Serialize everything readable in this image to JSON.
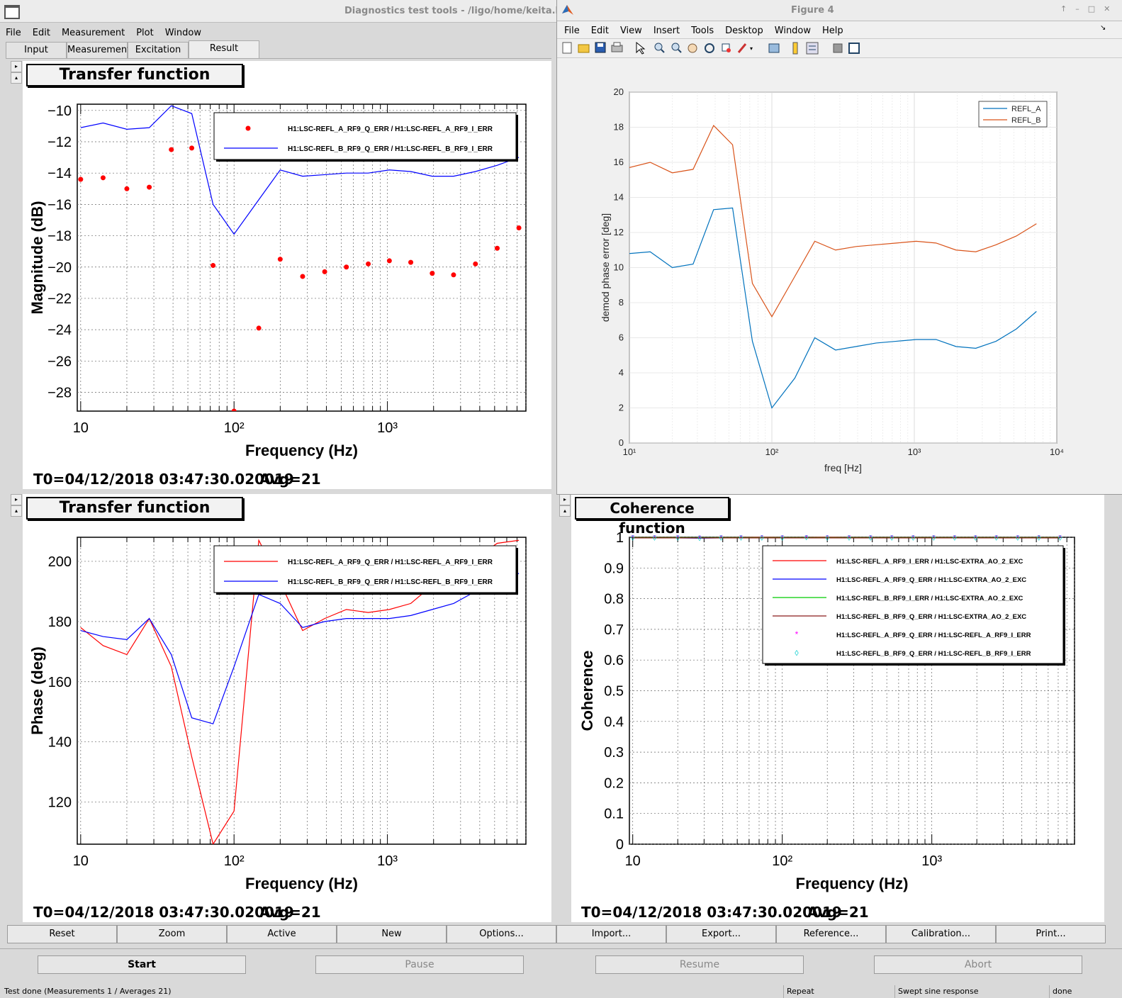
{
  "main_window": {
    "title": "Diagnostics test tools - /ligo/home/keita.l",
    "menu": [
      "File",
      "Edit",
      "Measurement",
      "Plot",
      "Window"
    ],
    "tabs": [
      "Input",
      "Measurement",
      "Excitation",
      "Result"
    ],
    "active_tab": "Result"
  },
  "figure_window": {
    "title": "Figure 4",
    "menu": [
      "File",
      "Edit",
      "View",
      "Insert",
      "Tools",
      "Desktop",
      "Window",
      "Help"
    ]
  },
  "buttons": {
    "row": [
      "Reset",
      "Zoom",
      "Active",
      "New",
      "Options...",
      "Import...",
      "Export...",
      "Reference...",
      "Calibration...",
      "Print..."
    ],
    "start": "Start",
    "pause": "Pause",
    "resume": "Resume",
    "abort": "Abort"
  },
  "status": {
    "message": "Test done (Measurements 1 / Averages 21)",
    "mode": "Repeat",
    "type": "Swept sine response",
    "state": "done"
  },
  "colors": {
    "red": "#ff0000",
    "blue": "#0000ff",
    "green": "#00cc00",
    "darkred": "#8b1a1a",
    "magenta": "#ff00ff",
    "cyan": "#00cccc",
    "matlab_blue": "#0072bd",
    "matlab_orange": "#d95319"
  },
  "chart_data": [
    {
      "panel": "top-left",
      "type": "line",
      "panel_title": "Transfer function",
      "xlabel": "Frequency (Hz)",
      "ylabel": "Magnitude (dB)",
      "xscale": "log",
      "xlim": [
        9.5,
        8000
      ],
      "ylim": [
        -29.2,
        -9.6
      ],
      "yticks": [
        -10,
        -12,
        -14,
        -16,
        -18,
        -20,
        -22,
        -24,
        -26,
        -28
      ],
      "xtick_labels": [
        "10",
        "10²",
        "10³"
      ],
      "x": [
        10,
        14,
        20,
        28,
        39,
        53,
        73,
        100,
        145,
        200,
        280,
        390,
        540,
        750,
        1030,
        1420,
        1960,
        2700,
        3750,
        5200,
        7200
      ],
      "series": [
        {
          "name": "H1:LSC-REFL_A_RF9_Q_ERR / H1:LSC-REFL_A_RF9_I_ERR",
          "style": "markers",
          "color": "#ff0000",
          "values": [
            -14.4,
            -14.3,
            -15.0,
            -14.9,
            -12.5,
            -12.4,
            -19.9,
            -29.2,
            -23.9,
            -19.5,
            -20.6,
            -20.3,
            -20.0,
            -19.8,
            -19.6,
            -19.7,
            -20.4,
            -20.5,
            -19.8,
            -18.8,
            -17.5
          ]
        },
        {
          "name": "H1:LSC-REFL_B_RF9_Q_ERR / H1:LSC-REFL_B_RF9_I_ERR",
          "style": "line",
          "color": "#0000ff",
          "values": [
            -11.1,
            -10.8,
            -11.2,
            -11.1,
            -9.7,
            -10.2,
            -16.0,
            -17.9,
            -15.7,
            -13.8,
            -14.2,
            -14.1,
            -14.0,
            -14.0,
            -13.8,
            -13.9,
            -14.2,
            -14.2,
            -13.9,
            -13.5,
            -13.0
          ]
        }
      ],
      "footer": "T0=04/12/2018 03:47:30.020019",
      "avg": "Avg=21"
    },
    {
      "panel": "bottom-left",
      "type": "line",
      "panel_title": "Transfer function",
      "xlabel": "Frequency (Hz)",
      "ylabel": "Phase (deg)",
      "xscale": "log",
      "xlim": [
        9.5,
        8000
      ],
      "ylim": [
        106,
        208
      ],
      "yticks": [
        120,
        140,
        160,
        180,
        200
      ],
      "xtick_labels": [
        "10",
        "10²",
        "10³"
      ],
      "x": [
        10,
        14,
        20,
        28,
        39,
        53,
        73,
        100,
        145,
        200,
        280,
        390,
        540,
        750,
        1030,
        1420,
        1960,
        2700,
        3750,
        5200,
        7200
      ],
      "series": [
        {
          "name": "H1:LSC-REFL_A_RF9_Q_ERR / H1:LSC-REFL_A_RF9_I_ERR",
          "style": "line",
          "color": "#ff0000",
          "values": [
            178,
            172,
            169,
            181,
            165,
            135,
            106,
            117,
            207,
            193,
            177,
            181,
            184,
            183,
            184,
            186,
            192,
            198,
            201,
            206,
            207
          ]
        },
        {
          "name": "H1:LSC-REFL_B_RF9_Q_ERR / H1:LSC-REFL_B_RF9_I_ERR",
          "style": "line",
          "color": "#0000ff",
          "values": [
            177,
            175,
            174,
            181,
            169,
            148,
            146,
            165,
            189,
            186,
            178,
            180,
            181,
            181,
            181,
            182,
            184,
            186,
            190,
            193,
            196
          ]
        }
      ],
      "footer": "T0=04/12/2018 03:47:30.020019",
      "avg": "Avg=21"
    },
    {
      "panel": "top-right",
      "type": "line",
      "xlabel": "freq [Hz]",
      "ylabel": "demod phase error [deg]",
      "xscale": "log",
      "xlim": [
        10,
        10000
      ],
      "ylim": [
        0,
        20
      ],
      "yticks": [
        0,
        2,
        4,
        6,
        8,
        10,
        12,
        14,
        16,
        18,
        20
      ],
      "xtick_labels": [
        "10¹",
        "10²",
        "10³",
        "10⁴"
      ],
      "grid": true,
      "legend_position": "top-right",
      "x": [
        10,
        14,
        20,
        28,
        39,
        53,
        73,
        100,
        145,
        200,
        280,
        390,
        540,
        750,
        1030,
        1420,
        1960,
        2700,
        3750,
        5200,
        7200
      ],
      "series": [
        {
          "name": "REFL_A",
          "color": "#0072bd",
          "values": [
            10.8,
            10.9,
            10.0,
            10.2,
            13.3,
            13.4,
            5.8,
            2.0,
            3.7,
            6.0,
            5.3,
            5.5,
            5.7,
            5.8,
            5.9,
            5.9,
            5.5,
            5.4,
            5.8,
            6.5,
            7.5
          ]
        },
        {
          "name": "REFL_B",
          "color": "#d95319",
          "values": [
            15.7,
            16.0,
            15.4,
            15.6,
            18.1,
            17.0,
            9.1,
            7.2,
            9.5,
            11.5,
            11.0,
            11.2,
            11.3,
            11.4,
            11.5,
            11.4,
            11.0,
            10.9,
            11.3,
            11.8,
            12.5
          ]
        }
      ]
    },
    {
      "panel": "bottom-right",
      "type": "line",
      "panel_title": "Coherence function",
      "xlabel": "Frequency (Hz)",
      "ylabel": "Coherence",
      "xscale": "log",
      "xlim": [
        9.5,
        9000
      ],
      "ylim": [
        0,
        1
      ],
      "yticks": [
        0,
        0.1,
        0.2,
        0.3,
        0.4,
        0.5,
        0.6,
        0.7,
        0.8,
        0.9,
        1
      ],
      "ytick_labels": [
        "0",
        "0.1",
        "0.2",
        "0.3",
        "0.4",
        "0.5",
        "0.6",
        "0.7",
        "0.8",
        "0.9",
        "1"
      ],
      "xtick_labels": [
        "10",
        "10²",
        "10³"
      ],
      "x": [
        10,
        14,
        20,
        28,
        39,
        53,
        73,
        100,
        145,
        200,
        280,
        390,
        540,
        750,
        1030,
        1420,
        1960,
        2700,
        3750,
        5200,
        7200
      ],
      "series": [
        {
          "name": "H1:LSC-REFL_A_RF9_I_ERR / H1:LSC-EXTRA_AO_2_EXC",
          "style": "line",
          "color": "#ff0000",
          "values": [
            0.999,
            0.999,
            0.999,
            0.998,
            0.999,
            0.999,
            1,
            0.999,
            0.999,
            1,
            0.999,
            0.999,
            0.999,
            0.999,
            0.999,
            0.999,
            0.999,
            0.999,
            0.999,
            0.999,
            0.999
          ]
        },
        {
          "name": "H1:LSC-REFL_A_RF9_Q_ERR / H1:LSC-EXTRA_AO_2_EXC",
          "style": "line",
          "color": "#0000ff",
          "values": [
            0.998,
            0.998,
            0.998,
            0.997,
            0.998,
            0.998,
            0.999,
            0.998,
            0.998,
            0.999,
            0.998,
            0.998,
            0.998,
            0.998,
            0.998,
            0.998,
            0.998,
            0.998,
            0.998,
            0.998,
            0.998
          ]
        },
        {
          "name": "H1:LSC-REFL_B_RF9_I_ERR / H1:LSC-EXTRA_AO_2_EXC",
          "style": "line",
          "color": "#00cc00",
          "values": [
            0.999,
            0.999,
            0.999,
            0.999,
            0.999,
            0.999,
            0.999,
            0.999,
            0.999,
            0.999,
            0.999,
            0.999,
            0.999,
            0.999,
            0.999,
            0.999,
            0.999,
            0.999,
            0.999,
            0.999,
            0.999
          ]
        },
        {
          "name": "H1:LSC-REFL_B_RF9_Q_ERR / H1:LSC-EXTRA_AO_2_EXC",
          "style": "line",
          "color": "#8b1a1a",
          "values": [
            0.998,
            0.998,
            0.998,
            0.998,
            0.998,
            0.998,
            0.998,
            0.998,
            0.998,
            0.998,
            0.998,
            0.998,
            0.998,
            0.998,
            0.998,
            0.998,
            0.998,
            0.998,
            0.998,
            0.998,
            0.998
          ]
        },
        {
          "name": "H1:LSC-REFL_A_RF9_Q_ERR / H1:LSC-REFL_A_RF9_I_ERR",
          "style": "markers",
          "marker": "*",
          "color": "#ff00ff",
          "values": [
            0.999,
            0.999,
            0.999,
            0.998,
            0.999,
            0.999,
            1,
            0.999,
            0.999,
            1,
            0.999,
            0.999,
            0.999,
            0.999,
            0.999,
            0.999,
            0.999,
            0.999,
            0.999,
            1,
            0.999
          ]
        },
        {
          "name": "H1:LSC-REFL_B_RF9_Q_ERR / H1:LSC-REFL_B_RF9_I_ERR",
          "style": "markers",
          "marker": "◊",
          "color": "#00cccc",
          "values": [
            0.999,
            0.999,
            0.999,
            0.998,
            0.999,
            0.999,
            0.999,
            0.999,
            1,
            0.999,
            0.999,
            0.999,
            0.999,
            0.999,
            0.999,
            0.999,
            0.999,
            0.999,
            0.999,
            0.999,
            0.999
          ]
        }
      ],
      "footer": "T0=04/12/2018 03:47:30.020019",
      "avg": "Avg=21"
    }
  ]
}
